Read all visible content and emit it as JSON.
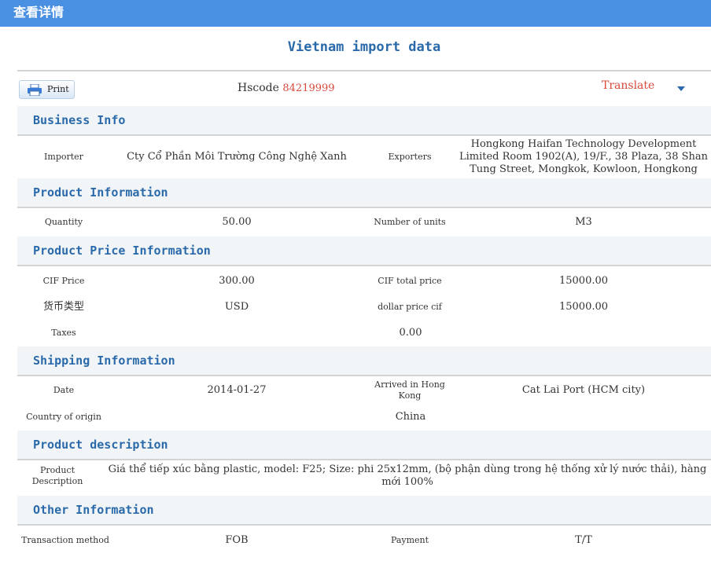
{
  "window": {
    "title": "查看详情"
  },
  "heading": "Vietnam import data",
  "toolbar": {
    "print_label": "Print",
    "hscode_label": "Hscode",
    "hscode_value": "84219999",
    "translate_label": "Translate"
  },
  "sections": {
    "business": {
      "title": "Business Info",
      "importer_label": "Importer",
      "importer_value": "Cty Cổ Phần Môi Trường Công Nghệ Xanh",
      "exporters_label": "Exporters",
      "exporters_value": "Hongkong Haifan Technology Development Limited Room 1902(A), 19/F., 38 Plaza, 38 Shan Tung Street, Mongkok, Kowloon, Hongkong"
    },
    "product": {
      "title": "Product Information",
      "quantity_label": "Quantity",
      "quantity_value": "50.00",
      "units_label": "Number of units",
      "units_value": "M3"
    },
    "price": {
      "title": "Product Price Information",
      "cif_price_label": "CIF Price",
      "cif_price_value": "300.00",
      "cif_total_label": "CIF total price",
      "cif_total_value": "15000.00",
      "currency_label": "货币类型",
      "currency_value": "USD",
      "dollar_cif_label": "dollar price cif",
      "dollar_cif_value": "15000.00",
      "taxes_label": "Taxes",
      "taxes_value": "0.00"
    },
    "shipping": {
      "title": "Shipping Information",
      "date_label": "Date",
      "date_value": "2014-01-27",
      "arrived_label": "Arrived in Hong Kong",
      "arrived_value": "Cat Lai Port (HCM city)",
      "origin_label": "Country of origin",
      "origin_value": "China"
    },
    "description": {
      "title": "Product description",
      "desc_label": "Product Description",
      "desc_value": "Giá thể tiếp xúc bằng plastic, model: F25; Size: phi 25x12mm, (bộ phận dùng trong hệ thống xử lý nước thải), hàng mới 100%"
    },
    "other": {
      "title": "Other Information",
      "transaction_label": "Transaction method",
      "transaction_value": "FOB",
      "payment_label": "Payment",
      "payment_value": "T/T"
    }
  },
  "colors": {
    "titlebar": "#4a90e2",
    "section_title": "#2a6aaa",
    "highlight": "#d84a3a"
  }
}
